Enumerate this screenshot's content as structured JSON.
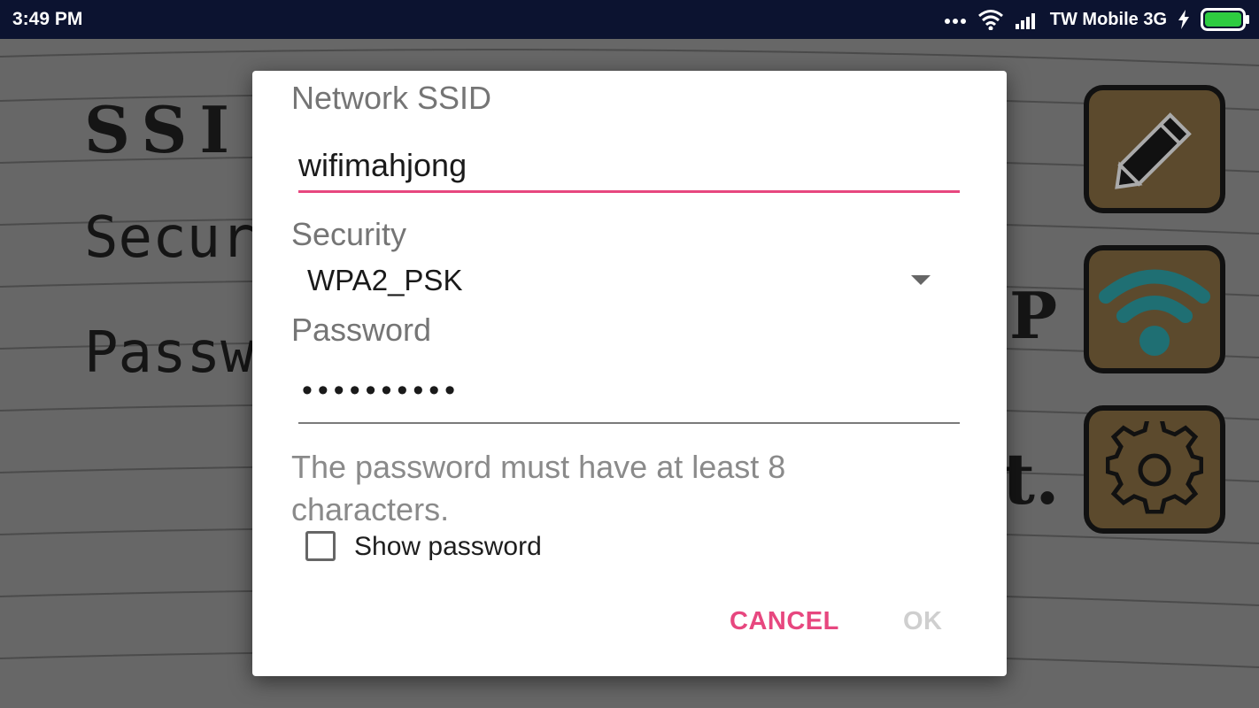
{
  "status_bar": {
    "time": "3:49 PM",
    "carrier": "TW Mobile 3G",
    "icons": [
      "more-dots-icon",
      "wifi-signal-icon",
      "cell-signal-icon",
      "charging-bolt-icon",
      "battery-icon"
    ],
    "battery_color": "#2ecc40"
  },
  "background": {
    "labels": [
      "SSI",
      "Securi",
      "Passwo"
    ],
    "side_buttons": [
      "edit-button",
      "wifi-button",
      "settings-button"
    ],
    "button_color": "#5c4a2d",
    "icon_color_wifi": "#1f6f73"
  },
  "dialog": {
    "ssid_label": "Network SSID",
    "ssid_value": "wifimahjong",
    "security_label": "Security",
    "security_value": "WPA2_PSK",
    "password_label": "Password",
    "password_value": "••••••••••",
    "hint": "The password must have at least 8 characters.",
    "show_password_label": "Show password",
    "cancel_label": "CANCEL",
    "ok_label": "OK",
    "accent_color": "#e7477f"
  }
}
